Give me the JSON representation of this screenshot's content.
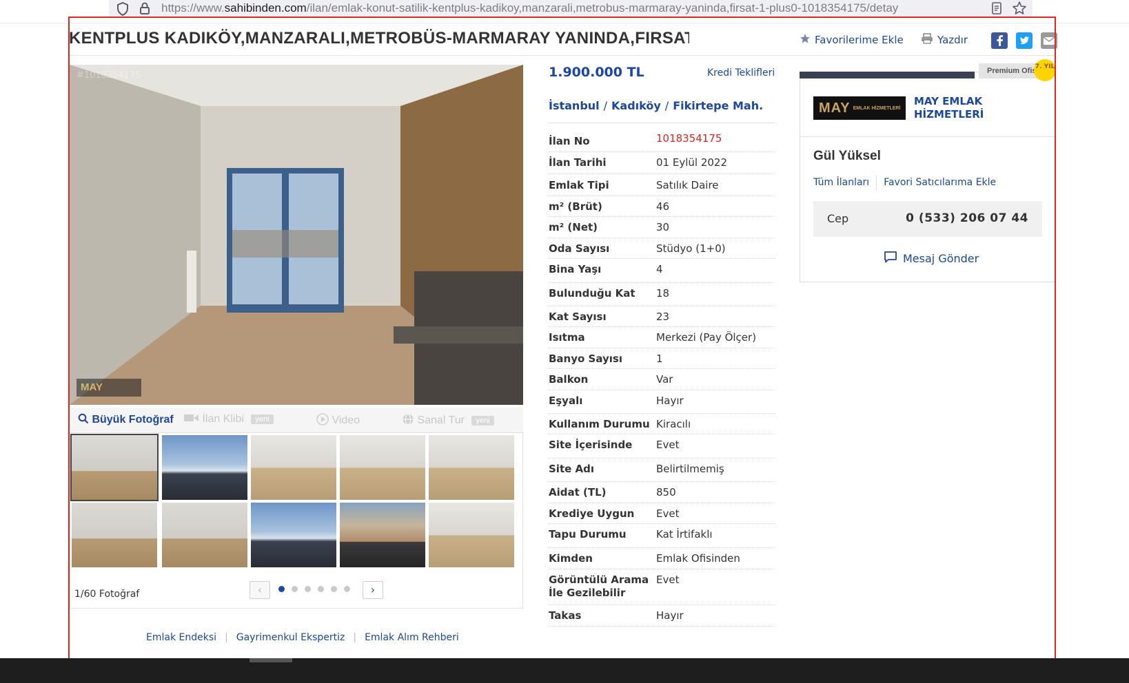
{
  "browser": {
    "url_prefix": "https://www.",
    "url_host": "sahibinden.com",
    "url_path": "/ilan/emlak-konut-satilik-kentplus-kadikoy,manzarali,metrobus-marmaray-yaninda,firsat-1-plus0-1018354175/detay"
  },
  "listing": {
    "title": "KENTPLUS KADIKÖY,MANZARALI,METROBÜS-MARMARAY YANINDA,FIRSAT ...",
    "favorite_label": "Favorilerime Ekle",
    "print_label": "Yazdır",
    "price": "1.900.000 TL",
    "credit_offers": "Kredi Teklifleri",
    "location": {
      "city": "İstanbul",
      "district": "Kadıköy",
      "neighborhood": "Fikirtepe Mah."
    }
  },
  "photo": {
    "id_watermark": "#1018354175",
    "logo_text": "MAY",
    "tab_big_photo": "Büyük Fotoğraf",
    "tab_video_clip": "İlan Klibi",
    "tab_video": "Video",
    "tab_virtual_tour": "Sanal Tur",
    "new_badge": "yeni",
    "counter": "1/60 Fotoğraf",
    "thumbnails": [
      "room",
      "sky",
      "kitchen",
      "kitchen",
      "kitchen",
      "room",
      "room",
      "sky",
      "city",
      "kitchen"
    ]
  },
  "details": [
    {
      "key": "İlan No",
      "value": "1018354175"
    },
    {
      "key": "İlan Tarihi",
      "value": "01 Eylül 2022"
    },
    {
      "key": "Emlak Tipi",
      "value": "Satılık Daire"
    },
    {
      "key": "m² (Brüt)",
      "value": "46"
    },
    {
      "key": "m² (Net)",
      "value": "30"
    },
    {
      "key": "Oda Sayısı",
      "value": "Stüdyo (1+0)"
    },
    {
      "key": "Bina Yaşı",
      "value": "4"
    },
    {
      "key": "Bulunduğu Kat",
      "value": "18"
    },
    {
      "key": "Kat Sayısı",
      "value": "23"
    },
    {
      "key": "Isıtma",
      "value": "Merkezi (Pay Ölçer)"
    },
    {
      "key": "Banyo Sayısı",
      "value": "1"
    },
    {
      "key": "Balkon",
      "value": "Var"
    },
    {
      "key": "Eşyalı",
      "value": "Hayır"
    },
    {
      "key": "Kullanım Durumu",
      "value": "Kiracılı"
    },
    {
      "key": "Site İçerisinde",
      "value": "Evet"
    },
    {
      "key": "Site Adı",
      "value": "Belirtilmemiş"
    },
    {
      "key": "Aidat (TL)",
      "value": "850"
    },
    {
      "key": "Krediye Uygun",
      "value": "Evet"
    },
    {
      "key": "Tapu Durumu",
      "value": "Kat İrtifaklı"
    },
    {
      "key": "Kimden",
      "value": "Emlak Ofisinden"
    },
    {
      "key": "Görüntülü Arama İle Gezilebilir",
      "value": "Evet"
    },
    {
      "key": "Takas",
      "value": "Hayır"
    }
  ],
  "footer_links": [
    "Emlak Endeksi",
    "Gayrimenkul Ekspertiz",
    "Emlak Alım Rehberi"
  ],
  "seller": {
    "premium_label": "Premium Ofis",
    "years_badge": "7. YIL",
    "logo_text": "MAY",
    "logo_sub": "EMLAK HİZMETLERİ",
    "office_name": "MAY EMLAK HİZMETLERİ",
    "agent_name": "Gül Yüksel",
    "all_listings": "Tüm İlanları",
    "add_favorite_seller": "Favori Satıcılarıma Ekle",
    "phone_label": "Cep",
    "phone_number": "0 (533) 206 07 44",
    "message_label": "Mesaj Gönder"
  },
  "colors": {
    "link_blue": "#1b47a1",
    "alert_red": "#e02424",
    "frame_red": "#e02424"
  }
}
